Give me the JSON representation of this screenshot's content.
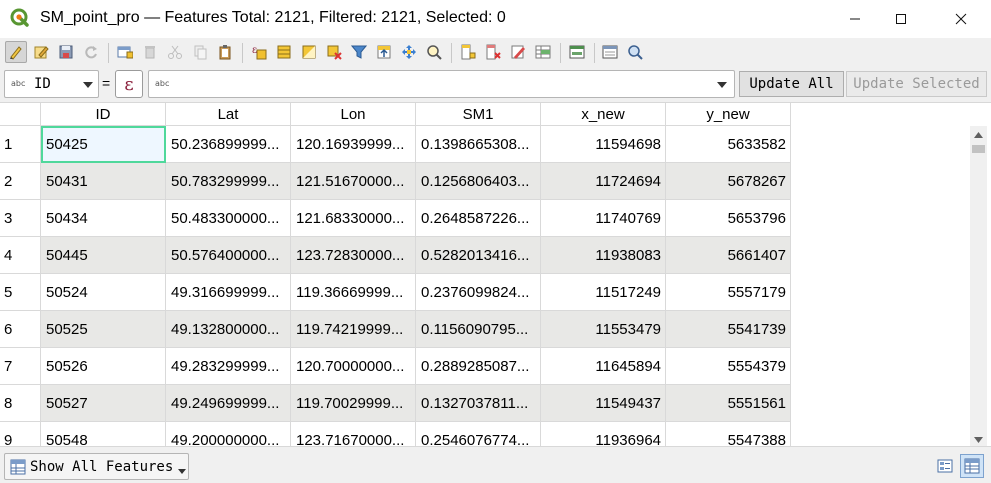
{
  "window": {
    "title": "SM_point_pro — Features Total: 2121, Filtered: 2121, Selected: 0"
  },
  "toolbar": {
    "icons": [
      "toggle-editing-icon",
      "multi-edit-icon",
      "save-edits-icon",
      "reload-icon",
      "add-feature-icon",
      "delete-feature-icon",
      "cut-icon",
      "copy-icon",
      "paste-icon",
      "select-by-expression-icon",
      "select-all-icon",
      "invert-selection-icon",
      "deselect-all-icon",
      "filter-select-icon",
      "move-selection-to-top-icon",
      "pan-to-selected-icon",
      "zoom-to-selected-icon",
      "new-field-icon",
      "delete-field-icon",
      "field-calculator-icon",
      "conditional-formatting-icon",
      "dock-toggle-icon",
      "actions-icon",
      "form-view-icon"
    ]
  },
  "expression_bar": {
    "field_type": "abc",
    "field": "ID",
    "equals": "=",
    "expression_button": "ε",
    "expression_type": "abc",
    "expression_value": "",
    "update_all": "Update All",
    "update_selected": "Update Selected"
  },
  "table": {
    "columns": [
      "ID",
      "Lat",
      "Lon",
      "SM1",
      "x_new",
      "y_new"
    ],
    "rows": [
      {
        "n": "1",
        "cells": [
          "50425",
          "50.236899999...",
          "120.16939999...",
          "0.1398665308...",
          "11594698",
          "5633582"
        ]
      },
      {
        "n": "2",
        "cells": [
          "50431",
          "50.783299999...",
          "121.51670000...",
          "0.1256806403...",
          "11724694",
          "5678267"
        ]
      },
      {
        "n": "3",
        "cells": [
          "50434",
          "50.483300000...",
          "121.68330000...",
          "0.2648587226...",
          "11740769",
          "5653796"
        ]
      },
      {
        "n": "4",
        "cells": [
          "50445",
          "50.576400000...",
          "123.72830000...",
          "0.5282013416...",
          "11938083",
          "5661407"
        ]
      },
      {
        "n": "5",
        "cells": [
          "50524",
          "49.316699999...",
          "119.36669999...",
          "0.2376099824...",
          "11517249",
          "5557179"
        ]
      },
      {
        "n": "6",
        "cells": [
          "50525",
          "49.132800000...",
          "119.74219999...",
          "0.1156090795...",
          "11553479",
          "5541739"
        ]
      },
      {
        "n": "7",
        "cells": [
          "50526",
          "49.283299999...",
          "120.70000000...",
          "0.2889285087...",
          "11645894",
          "5554379"
        ]
      },
      {
        "n": "8",
        "cells": [
          "50527",
          "49.249699999...",
          "119.70029999...",
          "0.1327037811...",
          "11549437",
          "5551561"
        ]
      },
      {
        "n": "9",
        "cells": [
          "50548",
          "49.200000000...",
          "123.71670000...",
          "0.2546076774...",
          "11936964",
          "5547388"
        ]
      }
    ]
  },
  "footer": {
    "show_features": "Show All Features"
  },
  "colors": {
    "selected_cell_border": "#4fd89b",
    "alt_row": "#e8e8e6"
  }
}
